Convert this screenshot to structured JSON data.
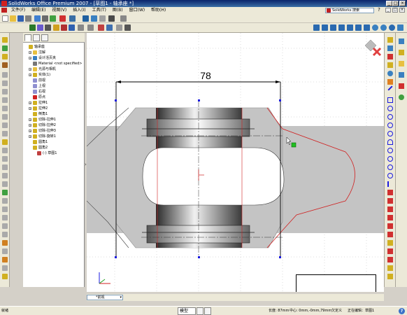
{
  "window": {
    "title": "SolidWorks Office Premium 2007 - [草图1 - 轴承座 *]",
    "buttons": [
      "_",
      "□",
      "×"
    ]
  },
  "menubar": {
    "items": [
      "文件(F)",
      "编辑(E)",
      "视图(V)",
      "插入(I)",
      "工具(T)",
      "图(B)",
      "窗口(W)",
      "帮助(H)"
    ],
    "search_placeholder": "SolidWorks 搜索",
    "search_button": "?",
    "mdi_buttons": [
      "_",
      "□",
      "×"
    ]
  },
  "feature_manager": {
    "tabs": [
      "feature-tree",
      "property-manager",
      "configuration-manager"
    ],
    "items": [
      {
        "label": "轴承座",
        "icon": "part-icon",
        "expand": "",
        "indent": 0
      },
      {
        "label": "注解",
        "icon": "annotations-icon",
        "expand": "+",
        "indent": 1
      },
      {
        "label": "设计活页夹",
        "icon": "design-binder-icon",
        "expand": "+",
        "indent": 1
      },
      {
        "label": "Material <not specified>",
        "icon": "material-icon",
        "expand": "",
        "indent": 1
      },
      {
        "label": "光源与相机",
        "icon": "lights-icon",
        "expand": "+",
        "indent": 1
      },
      {
        "label": "实体(1)",
        "icon": "solid-body-icon",
        "expand": "+",
        "indent": 1
      },
      {
        "label": "前视",
        "icon": "plane-icon",
        "expand": "",
        "indent": 1
      },
      {
        "label": "上视",
        "icon": "plane-icon",
        "expand": "",
        "indent": 1
      },
      {
        "label": "右视",
        "icon": "plane-icon",
        "expand": "",
        "indent": 1
      },
      {
        "label": "原点",
        "icon": "origin-icon",
        "expand": "",
        "indent": 1
      },
      {
        "label": "拉伸1",
        "icon": "extrude-icon",
        "expand": "+",
        "indent": 1
      },
      {
        "label": "拉伸2",
        "icon": "extrude-icon",
        "expand": "+",
        "indent": 1
      },
      {
        "label": "倒角1",
        "icon": "chamfer-icon",
        "expand": "",
        "indent": 1
      },
      {
        "label": "切除-拉伸1",
        "icon": "cut-extrude-icon",
        "expand": "+",
        "indent": 1
      },
      {
        "label": "切除-拉伸2",
        "icon": "cut-extrude-icon",
        "expand": "+",
        "indent": 1
      },
      {
        "label": "切除-拉伸3",
        "icon": "cut-extrude-icon",
        "expand": "+",
        "indent": 1
      },
      {
        "label": "切除-旋转1",
        "icon": "cut-revolve-icon",
        "expand": "+",
        "indent": 1
      },
      {
        "label": "圆角1",
        "icon": "fillet-icon",
        "expand": "",
        "indent": 1
      },
      {
        "label": "圆角2",
        "icon": "fillet-icon",
        "expand": "",
        "indent": 1
      },
      {
        "label": "(-) 草图1",
        "icon": "sketch-icon",
        "expand": "",
        "indent": 2
      }
    ]
  },
  "graphics": {
    "dimension_value": "78",
    "view_orientation": "*前视",
    "colors": {
      "part_gray": "#c0c0c0",
      "sketch_red": "#d02020",
      "dimension_black": "#000000",
      "endpoint_blue": "#1a1ae0",
      "selection_green": "#20c020"
    }
  },
  "sheet_tabs": {
    "items": [
      "模型",
      "",
      ""
    ]
  },
  "status": {
    "ready": "就绪",
    "length": "长度: 87mm",
    "center": "中心: 0mm,-0mm,79mm",
    "constraint": "欠定义",
    "editing": "正在编辑：草图1",
    "help": "?"
  }
}
